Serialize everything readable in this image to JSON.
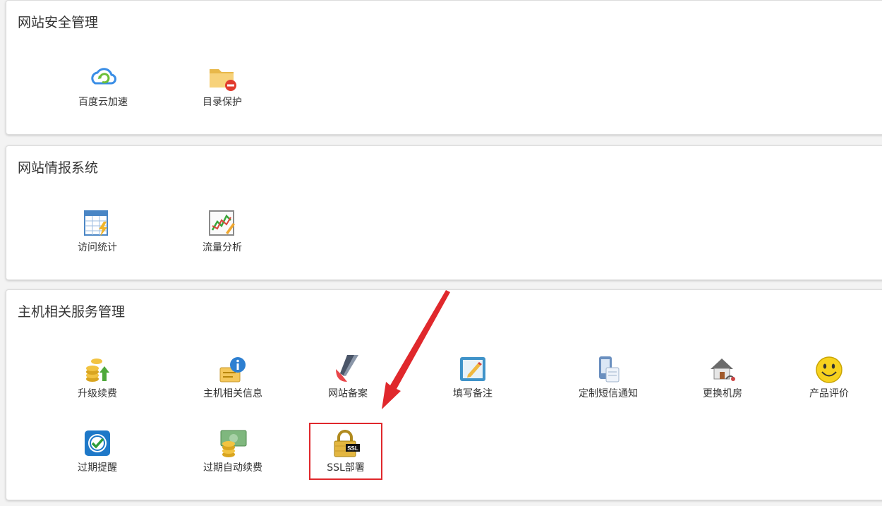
{
  "sections": [
    {
      "title": "网站安全管理",
      "items": [
        {
          "label": "百度云加速",
          "icon": "cloud-accelerate-icon"
        },
        {
          "label": "目录保护",
          "icon": "folder-protect-icon"
        }
      ]
    },
    {
      "title": "网站情报系统",
      "items": [
        {
          "label": "访问统计",
          "icon": "stats-table-icon"
        },
        {
          "label": "流量分析",
          "icon": "traffic-chart-icon"
        }
      ]
    },
    {
      "title": "主机相关服务管理",
      "items": [
        {
          "label": "升级续费",
          "icon": "coins-upgrade-icon"
        },
        {
          "label": "主机相关信息",
          "icon": "info-icon"
        },
        {
          "label": "网站备案",
          "icon": "record-pen-icon"
        },
        {
          "label": "填写备注",
          "icon": "edit-note-icon"
        },
        {
          "label": "定制短信通知",
          "icon": "sms-notify-icon"
        },
        {
          "label": "更换机房",
          "icon": "house-icon"
        },
        {
          "label": "产品评价",
          "icon": "smiley-icon"
        },
        {
          "label": "过期提醒",
          "icon": "clock-check-icon"
        },
        {
          "label": "过期自动续费",
          "icon": "money-renew-icon"
        },
        {
          "label": "SSL部署",
          "icon": "ssl-lock-icon"
        }
      ]
    }
  ],
  "annotation": {
    "highlight_color": "#e0282c"
  }
}
